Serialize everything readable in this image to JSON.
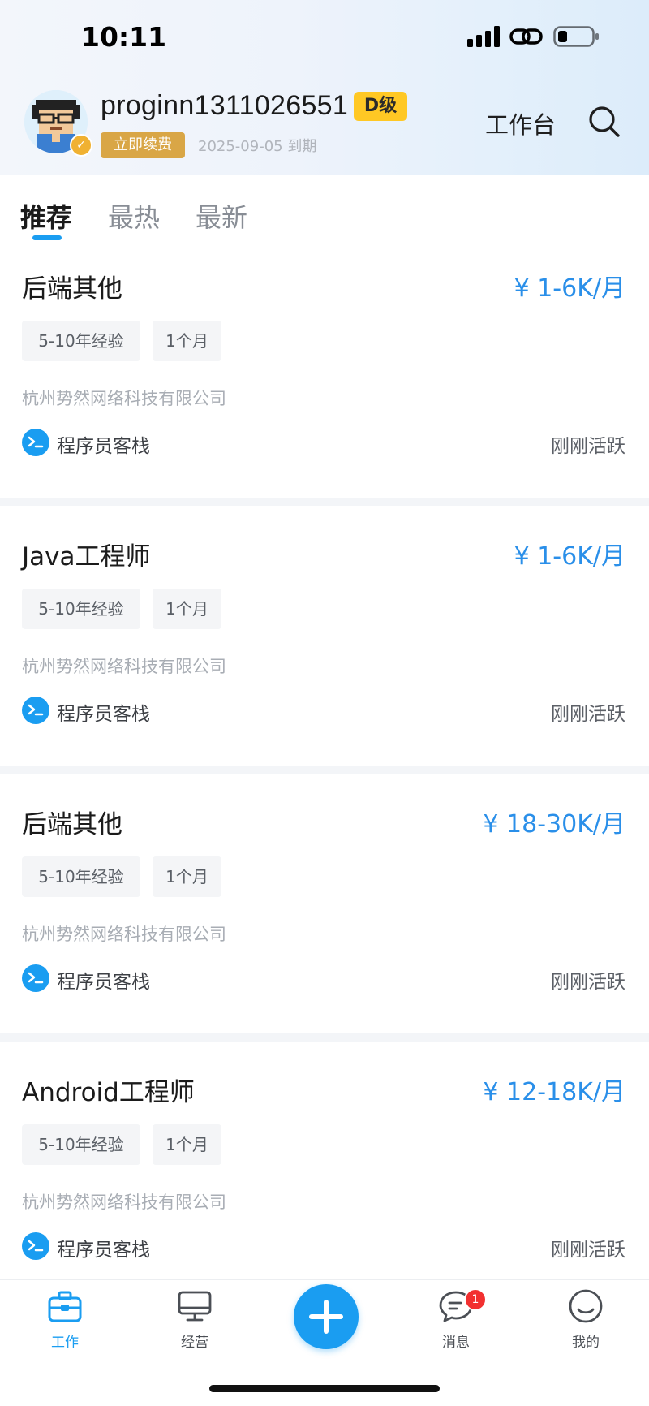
{
  "status_bar": {
    "time": "10:11"
  },
  "header": {
    "username": "proginn1311026551",
    "level": "D级",
    "renew_label": "立即续费",
    "expire_text": "2025-09-05 到期",
    "workbench_label": "工作台"
  },
  "tabs": [
    {
      "label": "推荐",
      "active": true
    },
    {
      "label": "最热",
      "active": false
    },
    {
      "label": "最新",
      "active": false
    }
  ],
  "jobs": [
    {
      "title": "后端其他",
      "salary": "¥ 1-6K/月",
      "tags": [
        "5-10年经验",
        "1个月"
      ],
      "company": "杭州势然网络科技有限公司",
      "source": "程序员客栈",
      "status": "刚刚活跃"
    },
    {
      "title": "Java工程师",
      "salary": "¥ 1-6K/月",
      "tags": [
        "5-10年经验",
        "1个月"
      ],
      "company": "杭州势然网络科技有限公司",
      "source": "程序员客栈",
      "status": "刚刚活跃"
    },
    {
      "title": "后端其他",
      "salary": "¥ 18-30K/月",
      "tags": [
        "5-10年经验",
        "1个月"
      ],
      "company": "杭州势然网络科技有限公司",
      "source": "程序员客栈",
      "status": "刚刚活跃"
    },
    {
      "title": "Android工程师",
      "salary": "¥ 12-18K/月",
      "tags": [
        "5-10年经验",
        "1个月"
      ],
      "company": "杭州势然网络科技有限公司",
      "source": "程序员客栈",
      "status": "刚刚活跃"
    }
  ],
  "bottom_nav": {
    "items": [
      {
        "label": "工作",
        "icon": "briefcase-icon",
        "active": true
      },
      {
        "label": "经营",
        "icon": "monitor-icon",
        "active": false
      },
      {
        "label": "消息",
        "icon": "chat-icon",
        "active": false,
        "badge": "1"
      },
      {
        "label": "我的",
        "icon": "smile-icon",
        "active": false
      }
    ],
    "fab_icon": "plus-icon"
  },
  "colors": {
    "accent": "#1a9df1",
    "salary": "#2a8fe9",
    "level_badge": "#ffc824",
    "renew": "#d9a646",
    "notification": "#f23030"
  }
}
